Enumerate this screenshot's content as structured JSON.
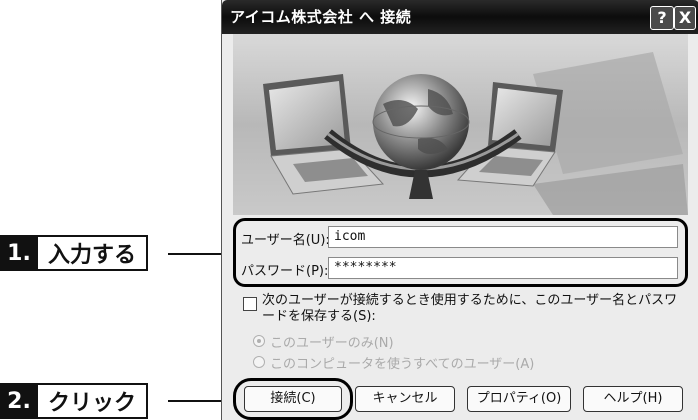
{
  "dialog": {
    "title": "アイコム株式会社 へ 接続",
    "help_button": "?",
    "close_button": "X"
  },
  "form": {
    "username_label": "ユーザー名(U):",
    "username_value": "icom",
    "password_label": "パスワード(P):",
    "password_value": "********",
    "save_checkbox_label": "次のユーザーが接続するとき使用するために、このユーザー名とパスワードを保存する(S):",
    "radio_me_only": "このユーザーのみ(N)",
    "radio_all_users": "このコンピュータを使うすべてのユーザー(A)"
  },
  "buttons": {
    "connect": "接続(C)",
    "cancel": "キャンセル",
    "properties": "プロパティ(O)",
    "help": "ヘルプ(H)"
  },
  "callouts": [
    {
      "number": "1.",
      "text": "入力する"
    },
    {
      "number": "2.",
      "text": "クリック"
    }
  ]
}
